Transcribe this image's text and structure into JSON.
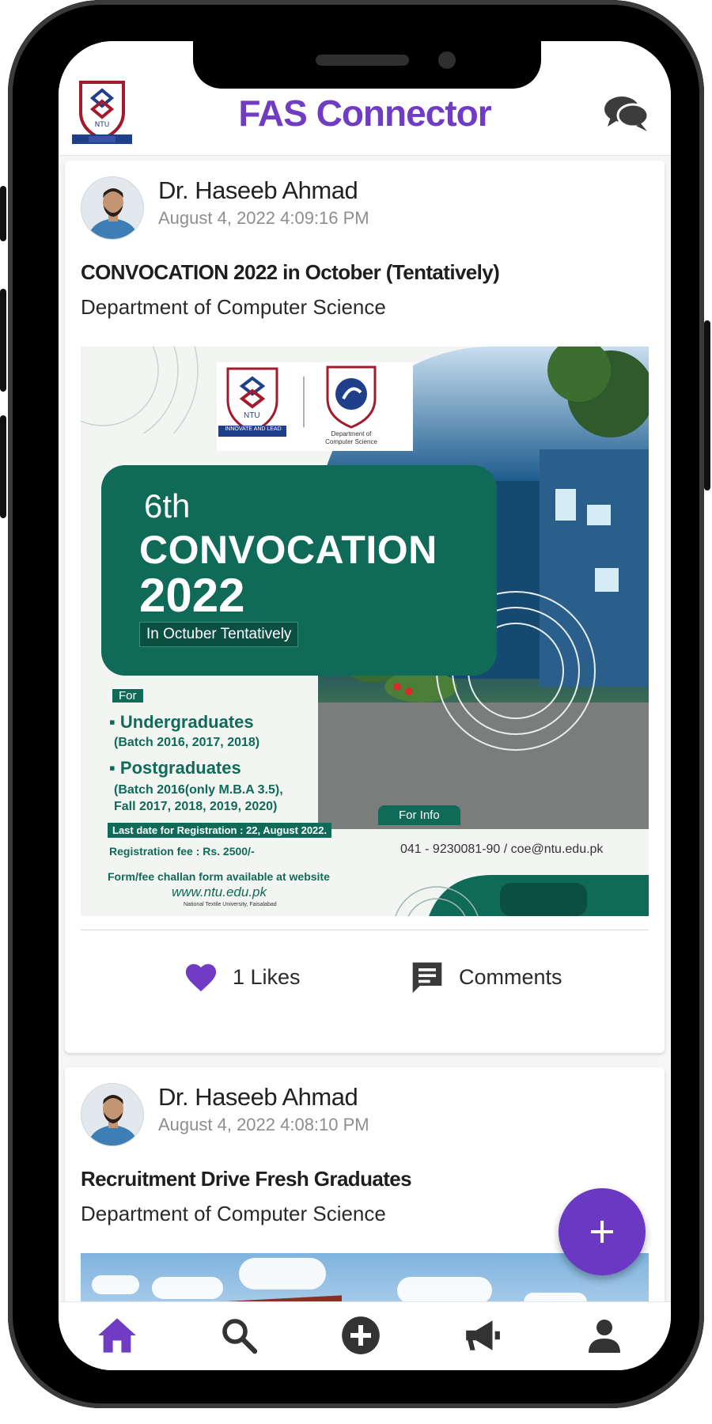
{
  "app": {
    "title": "FAS Connector",
    "accent_color": "#6f3cc3",
    "logo_icon": "ntu-logo",
    "chat_icon": "chat-bubbles-icon"
  },
  "posts": [
    {
      "author": "Dr. Haseeb Ahmad",
      "date": "August 4, 2022 4:09:16 PM",
      "title": "CONVOCATION 2022 in October (Tentatively)",
      "department": "Department of Computer Science",
      "poster": {
        "logo_text": "NTU",
        "logo_motto": "INNOVATE AND LEAD",
        "dept_logo_text": "Department of Computer Science",
        "edition": "6th",
        "headline": "CONVOCATION",
        "year": "2022",
        "tentative": "In Octuber Tentatively",
        "for_label": "For",
        "undergrad_label": "▪ Undergraduates",
        "undergrad_batch": "(Batch 2016, 2017, 2018)",
        "postgrad_label": "▪ Postgraduates",
        "postgrad_batch": "(Batch 2016(only M.B.A 3.5), Fall 2017, 2018, 2019, 2020)",
        "last_date": "Last date for Registration : 22, August 2022.",
        "fee": "Registration fee : Rs. 2500/-",
        "for_info": "For Info",
        "contact": "041 - 9230081-90  /  coe@ntu.edu.pk",
        "form_note": "Form/fee challan form available at website",
        "website": "www.ntu.edu.pk",
        "university": "National Textile University, Faisalabad"
      },
      "likes_label": "1  Likes",
      "comments_label": "Comments"
    },
    {
      "author": "Dr. Haseeb Ahmad",
      "date": "August 4, 2022 4:08:10 PM",
      "title": "Recruitment Drive Fresh Graduates",
      "department": "Department of Computer Science"
    }
  ],
  "fab": {
    "icon": "plus-icon"
  },
  "nav": {
    "items": [
      "home-icon",
      "search-icon",
      "add-circle-icon",
      "megaphone-icon",
      "person-icon"
    ],
    "active": "home-icon",
    "active_color": "#6f3cc3",
    "inactive_color": "#333333"
  }
}
